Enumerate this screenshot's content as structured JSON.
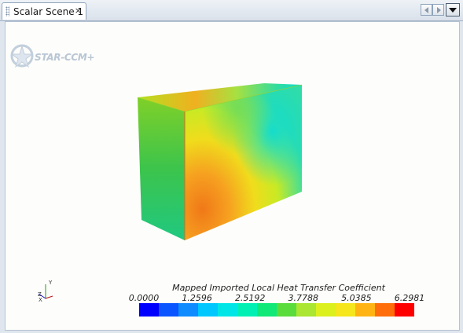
{
  "tab": {
    "title": "Scalar Scene 1",
    "close_glyph": "×"
  },
  "toolbar": {
    "scroll_left_icon": "chevron-left-icon",
    "scroll_right_icon": "chevron-right-icon",
    "menu_icon": "triangle-down-icon"
  },
  "logo": {
    "text": "STAR-CCM+"
  },
  "colorbar": {
    "title": "Mapped Imported Local Heat Transfer Coefficient",
    "ticks": [
      "0.0000",
      "1.2596",
      "2.5192",
      "3.7788",
      "5.0385",
      "6.2981"
    ],
    "min": 0.0,
    "max": 6.2981,
    "colors": [
      "#0000ff",
      "#0a55ff",
      "#0f8cff",
      "#00c8ff",
      "#00e6e6",
      "#00f0b4",
      "#10e878",
      "#5adc3c",
      "#aae632",
      "#dcf01e",
      "#f5e61e",
      "#ffb414",
      "#ff6e0a",
      "#ff0000"
    ]
  },
  "triad": {
    "x": "X",
    "y": "Y",
    "z": "Z"
  },
  "colors": {
    "tab_bg": "#ffffff",
    "viewport_bg": "#fdfdfb",
    "chrome": "#dfe6ee"
  }
}
